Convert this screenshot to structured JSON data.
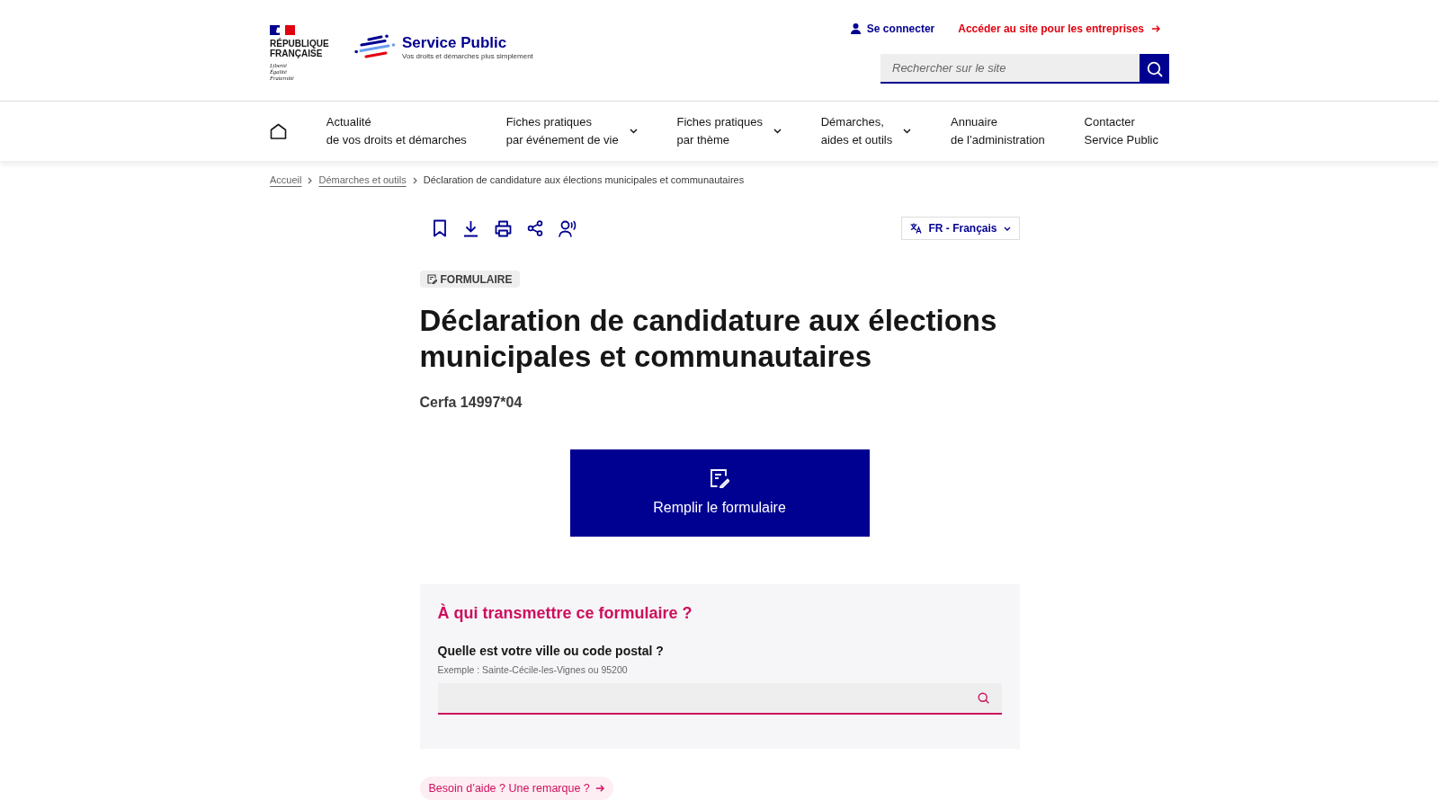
{
  "header": {
    "brand": {
      "republic_lines": [
        "RÉPUBLIQUE",
        "FRANÇAISE"
      ],
      "motto_lines": [
        "Liberté",
        "Égalité",
        "Fraternité"
      ],
      "site_name": "Service Public",
      "tagline": "Vos droits et démarches plus simplement"
    },
    "links": [
      {
        "kind": "account",
        "label": "Se connecter"
      },
      {
        "kind": "business",
        "label": "Accéder au site pour les entreprises"
      }
    ],
    "search": {
      "placeholder": "Rechercher sur le site"
    }
  },
  "nav": {
    "items": [
      {
        "lines": [
          "Actualité",
          "de vos droits et démarches"
        ],
        "has_menu": false
      },
      {
        "lines": [
          "Fiches pratiques",
          "par événement de vie"
        ],
        "has_menu": true
      },
      {
        "lines": [
          "Fiches pratiques",
          "par thème"
        ],
        "has_menu": true
      },
      {
        "lines": [
          "Démarches,",
          "aides et outils"
        ],
        "has_menu": true
      },
      {
        "lines": [
          "Annuaire",
          "de l’administration"
        ],
        "has_menu": false
      },
      {
        "lines": [
          "Contacter",
          "Service Public"
        ],
        "has_menu": false
      }
    ]
  },
  "breadcrumb": [
    {
      "label": "Accueil",
      "current": false
    },
    {
      "label": "Démarches et outils",
      "current": false
    },
    {
      "label": "Déclaration de candidature aux élections municipales et communautaires",
      "current": true
    }
  ],
  "language": {
    "label": "FR - Français"
  },
  "page": {
    "badge": "FORMULAIRE",
    "title": "Déclaration de candidature aux élections municipales et communautaires",
    "reference": "Cerfa 14997*04",
    "primary_action": "Remplir le formulaire"
  },
  "locator": {
    "title": "À qui transmettre ce formulaire ?",
    "label": "Quelle est votre ville ou code postal ?",
    "hint": "Exemple : Sainte-Cécile-les-Vignes ou 95200"
  },
  "help_link": {
    "label": "Besoin d’aide ? Une remarque ?"
  }
}
